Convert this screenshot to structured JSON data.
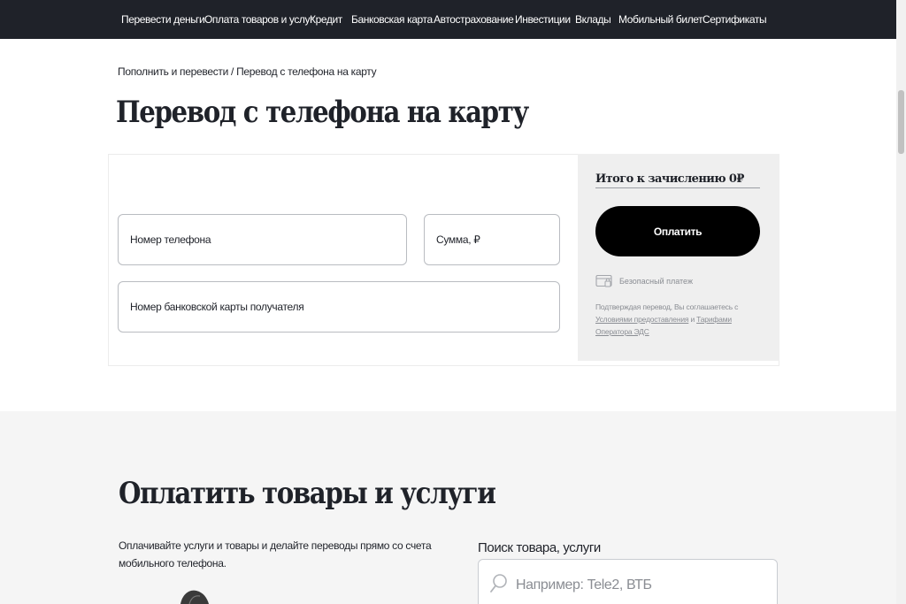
{
  "topnav": {
    "items": [
      {
        "label": "Перевести деньги"
      },
      {
        "label": "Оплата товаров и услуг"
      },
      {
        "label": "Кредит"
      },
      {
        "label": "Банковская карта"
      },
      {
        "label": "Автострахование"
      },
      {
        "label": "Инвестиции"
      },
      {
        "label": "Вклады"
      },
      {
        "label": "Мобильный билет"
      },
      {
        "label": "Сертификаты"
      }
    ]
  },
  "breadcrumb": {
    "parent": "Пополнить и перевести",
    "separator": " / ",
    "current": "Перевод с телефона на карту"
  },
  "page": {
    "title": "Перевод с телефона на карту"
  },
  "form": {
    "phone_placeholder": "Номер телефона",
    "amount_placeholder": "Сумма, ₽",
    "card_placeholder": "Номер банковской карты получателя"
  },
  "summary": {
    "total_label": "Итого к зачислению 0₽",
    "pay_button": "Оплатить",
    "secure_label": "Безопасный платеж",
    "legal_prefix": "Подтверждая перевод, Вы соглашаетесь с ",
    "legal_link1": "Условиями предоставления",
    "legal_middle": " и ",
    "legal_link2": "Тарифами Оператора ЭДС"
  },
  "section2": {
    "title": "Оплатить товары и услуги",
    "description": "Оплачивайте услуги и товары и делайте переводы прямо со счета мобильного телефона.",
    "search_label": "Поиск товара, услуги",
    "search_placeholder": "Например: Tele2, ВТБ"
  },
  "colors": {
    "nav_bg": "#1f2229",
    "button_bg": "#000000",
    "summary_bg": "#efefef",
    "section_bg": "#f5f5f5"
  }
}
